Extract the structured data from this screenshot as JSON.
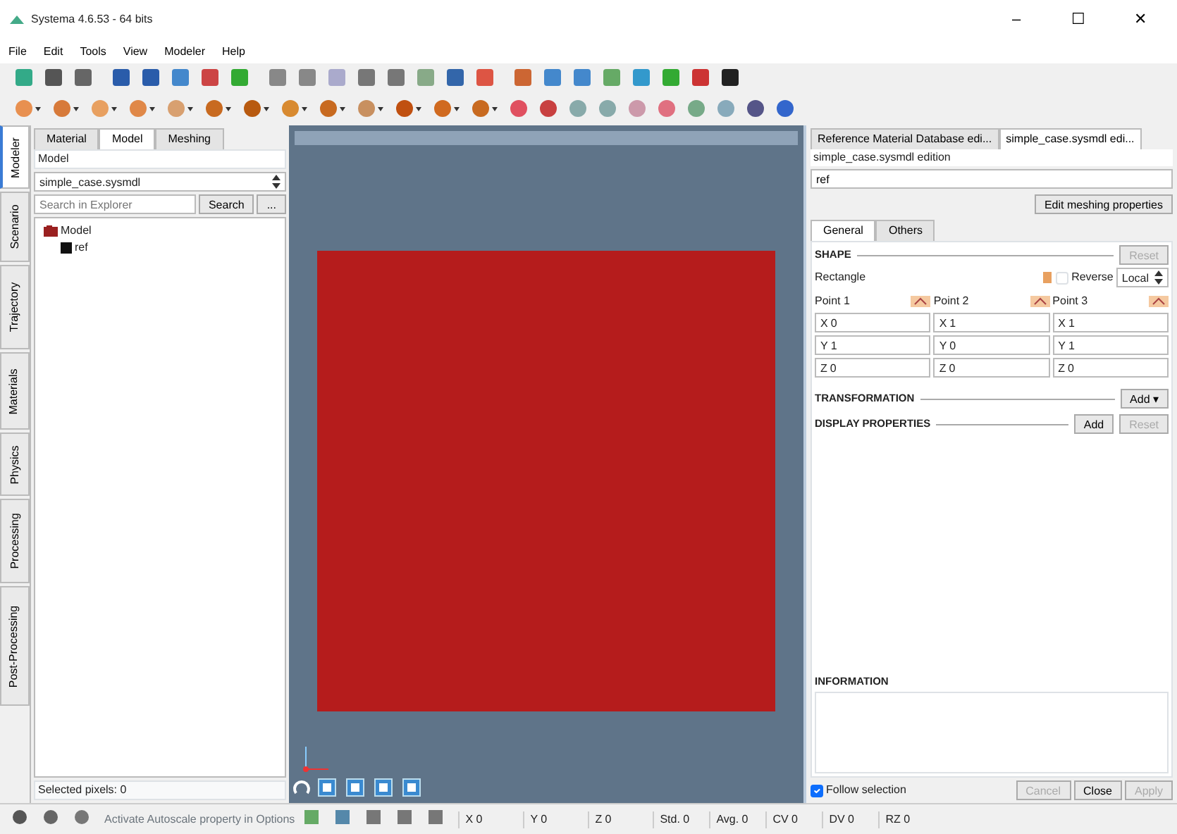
{
  "window": {
    "title": "Systema 4.6.53 - 64 bits",
    "controls": [
      "–",
      "☐",
      "✕"
    ]
  },
  "menu": [
    "File",
    "Edit",
    "Tools",
    "View",
    "Modeler",
    "Help"
  ],
  "side_tabs": [
    {
      "label": "Modeler",
      "selected": true
    },
    {
      "label": "Scenario",
      "selected": false
    },
    {
      "label": "Trajectory",
      "selected": false
    },
    {
      "label": "Materials",
      "selected": false
    },
    {
      "label": "Physics",
      "selected": false
    },
    {
      "label": "Processing",
      "selected": false
    },
    {
      "label": "Post-Processing",
      "selected": false
    }
  ],
  "left_panel": {
    "tabs": [
      {
        "label": "Material",
        "selected": false
      },
      {
        "label": "Model",
        "selected": true
      },
      {
        "label": "Meshing",
        "selected": false
      }
    ],
    "header": "Model",
    "file": "simple_case.sysmdl",
    "search": {
      "placeholder": "Search in Explorer",
      "button": "Search",
      "more": "..."
    },
    "tree": [
      {
        "label": "Model",
        "expanded": true,
        "children": [
          {
            "label": "ref"
          }
        ]
      }
    ],
    "status": "Selected pixels: 0"
  },
  "right_panel": {
    "tabs": [
      {
        "label": "Reference Material Database edi...",
        "selected": false
      },
      {
        "label": "simple_case.sysmdl edi...",
        "selected": true
      }
    ],
    "title": "simple_case.sysmdl edition",
    "name": "ref",
    "edit_button": "Edit meshing properties",
    "sub_tabs": [
      {
        "label": "General",
        "selected": true
      },
      {
        "label": "Others",
        "selected": false
      }
    ],
    "shape": {
      "heading": "SHAPE",
      "reset": "Reset",
      "type": "Rectangle",
      "reverse": {
        "label": "Reverse",
        "checked": false
      },
      "frame": "Local",
      "points": [
        {
          "label": "Point 1",
          "coords": [
            {
              "axis": "X",
              "value": "0"
            },
            {
              "axis": "Y",
              "value": "1"
            },
            {
              "axis": "Z",
              "value": "0"
            }
          ]
        },
        {
          "label": "Point 2",
          "coords": [
            {
              "axis": "X",
              "value": "1"
            },
            {
              "axis": "Y",
              "value": "0"
            },
            {
              "axis": "Z",
              "value": "0"
            }
          ]
        },
        {
          "label": "Point 3",
          "coords": [
            {
              "axis": "X",
              "value": "1"
            },
            {
              "axis": "Y",
              "value": "1"
            },
            {
              "axis": "Z",
              "value": "0"
            }
          ]
        }
      ]
    },
    "transformation": {
      "heading": "TRANSFORMATION",
      "add": "Add",
      "caret": "▾"
    },
    "display": {
      "heading": "DISPLAY PROPERTIES",
      "add": "Add",
      "reset": "Reset"
    },
    "information": {
      "heading": "INFORMATION"
    },
    "follow": {
      "label": "Follow selection",
      "checked": true
    },
    "buttons": [
      {
        "label": "Cancel",
        "disabled": true
      },
      {
        "label": "Close",
        "disabled": false
      },
      {
        "label": "Apply",
        "disabled": true
      }
    ]
  },
  "status_bar": {
    "message": "Activate Autoscale property in Options",
    "coords": [
      "X 0",
      "Y 0",
      "Z 0"
    ],
    "stats": [
      "Std. 0",
      "Avg. 0",
      "CV 0",
      "DV 0",
      "RZ 0"
    ]
  }
}
